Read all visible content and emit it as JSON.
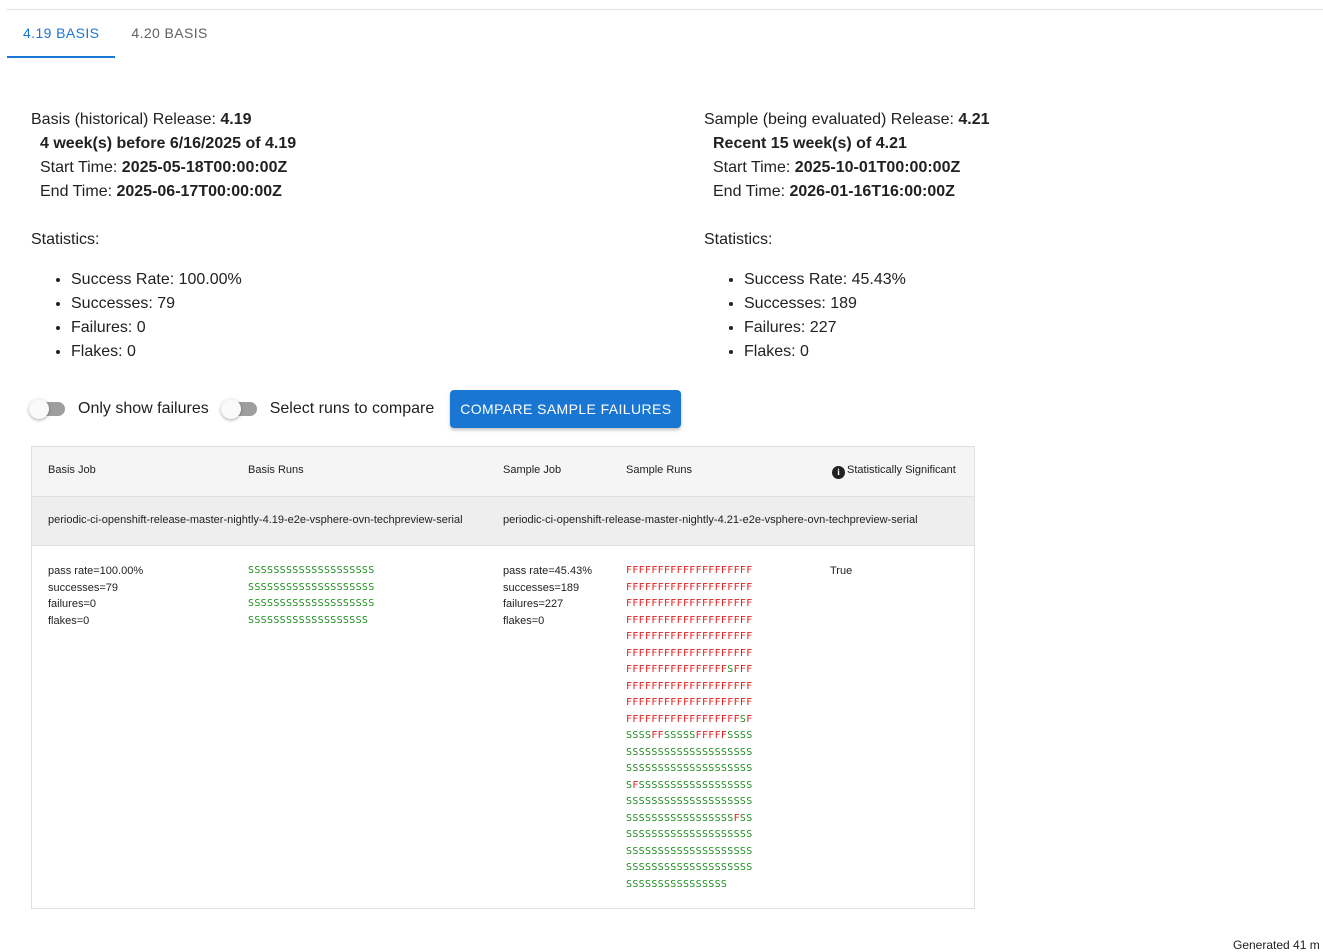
{
  "tabs": [
    {
      "label": "4.19 BASIS",
      "active": true
    },
    {
      "label": "4.20 BASIS",
      "active": false
    }
  ],
  "basis": {
    "release_label": "Basis (historical) Release: ",
    "release": "4.19",
    "window": "4 week(s) before 6/16/2025 of 4.19",
    "start_label": "Start Time: ",
    "start": "2025-05-18T00:00:00Z",
    "end_label": "End Time: ",
    "end": "2025-06-17T00:00:00Z",
    "stats_title": "Statistics:",
    "stats": [
      "Success Rate: 100.00%",
      "Successes: 79",
      "Failures: 0",
      "Flakes: 0"
    ]
  },
  "sample": {
    "release_label": "Sample (being evaluated) Release: ",
    "release": "4.21",
    "window": "Recent 15 week(s) of 4.21",
    "start_label": "Start Time: ",
    "start": "2025-10-01T00:00:00Z",
    "end_label": "End Time: ",
    "end": "2026-01-16T16:00:00Z",
    "stats_title": "Statistics:",
    "stats": [
      "Success Rate: 45.43%",
      "Successes: 189",
      "Failures: 227",
      "Flakes: 0"
    ]
  },
  "controls": {
    "only_failures_label": "Only show failures",
    "select_runs_label": "Select runs to compare",
    "compare_button": "COMPARE SAMPLE FAILURES"
  },
  "table": {
    "headers": {
      "basis_job": "Basis Job",
      "basis_runs": "Basis Runs",
      "sample_job": "Sample Job",
      "sample_runs": "Sample Runs",
      "significant": "Statistically Significant"
    },
    "basis_job_name": "periodic-ci-openshift-release-master-nightly-4.19-e2e-vsphere-ovn-techpreview-serial",
    "sample_job_name": "periodic-ci-openshift-release-master-nightly-4.21-e2e-vsphere-ovn-techpreview-serial",
    "basis_stats": [
      "pass rate=100.00%",
      "successes=79",
      "failures=0",
      "flakes=0"
    ],
    "sample_stats": [
      "pass rate=45.43%",
      "successes=189",
      "failures=227",
      "flakes=0"
    ],
    "basis_runs": [
      "SSSSSSSSSSSSSSSSSSSS",
      "SSSSSSSSSSSSSSSSSSSS",
      "SSSSSSSSSSSSSSSSSSSS",
      "SSSSSSSSSSSSSSSSSSS"
    ],
    "sample_runs": [
      "FFFFFFFFFFFFFFFFFFFF",
      "FFFFFFFFFFFFFFFFFFFF",
      "FFFFFFFFFFFFFFFFFFFF",
      "FFFFFFFFFFFFFFFFFFFF",
      "FFFFFFFFFFFFFFFFFFFF",
      "FFFFFFFFFFFFFFFFFFFF",
      "FFFFFFFFFFFFFFFFSFFF",
      "FFFFFFFFFFFFFFFFFFFF",
      "FFFFFFFFFFFFFFFFFFFF",
      "FFFFFFFFFFFFFFFFFFSF",
      "SSSSFFSSSSSFFFFFSSSS",
      "SSSSSSSSSSSSSSSSSSSS",
      "SSSSSSSSSSSSSSSSSSSS",
      "SFSSSSSSSSSSSSSSSSSS",
      "SSSSSSSSSSSSSSSSSSSS",
      "SSSSSSSSSSSSSSSSSFSS",
      "SSSSSSSSSSSSSSSSSSSS",
      "SSSSSSSSSSSSSSSSSSSS",
      "SSSSSSSSSSSSSSSSSSSS",
      "SSSSSSSSSSSSSSSS"
    ],
    "significant_value": "True"
  },
  "footer": "Generated 41 m"
}
